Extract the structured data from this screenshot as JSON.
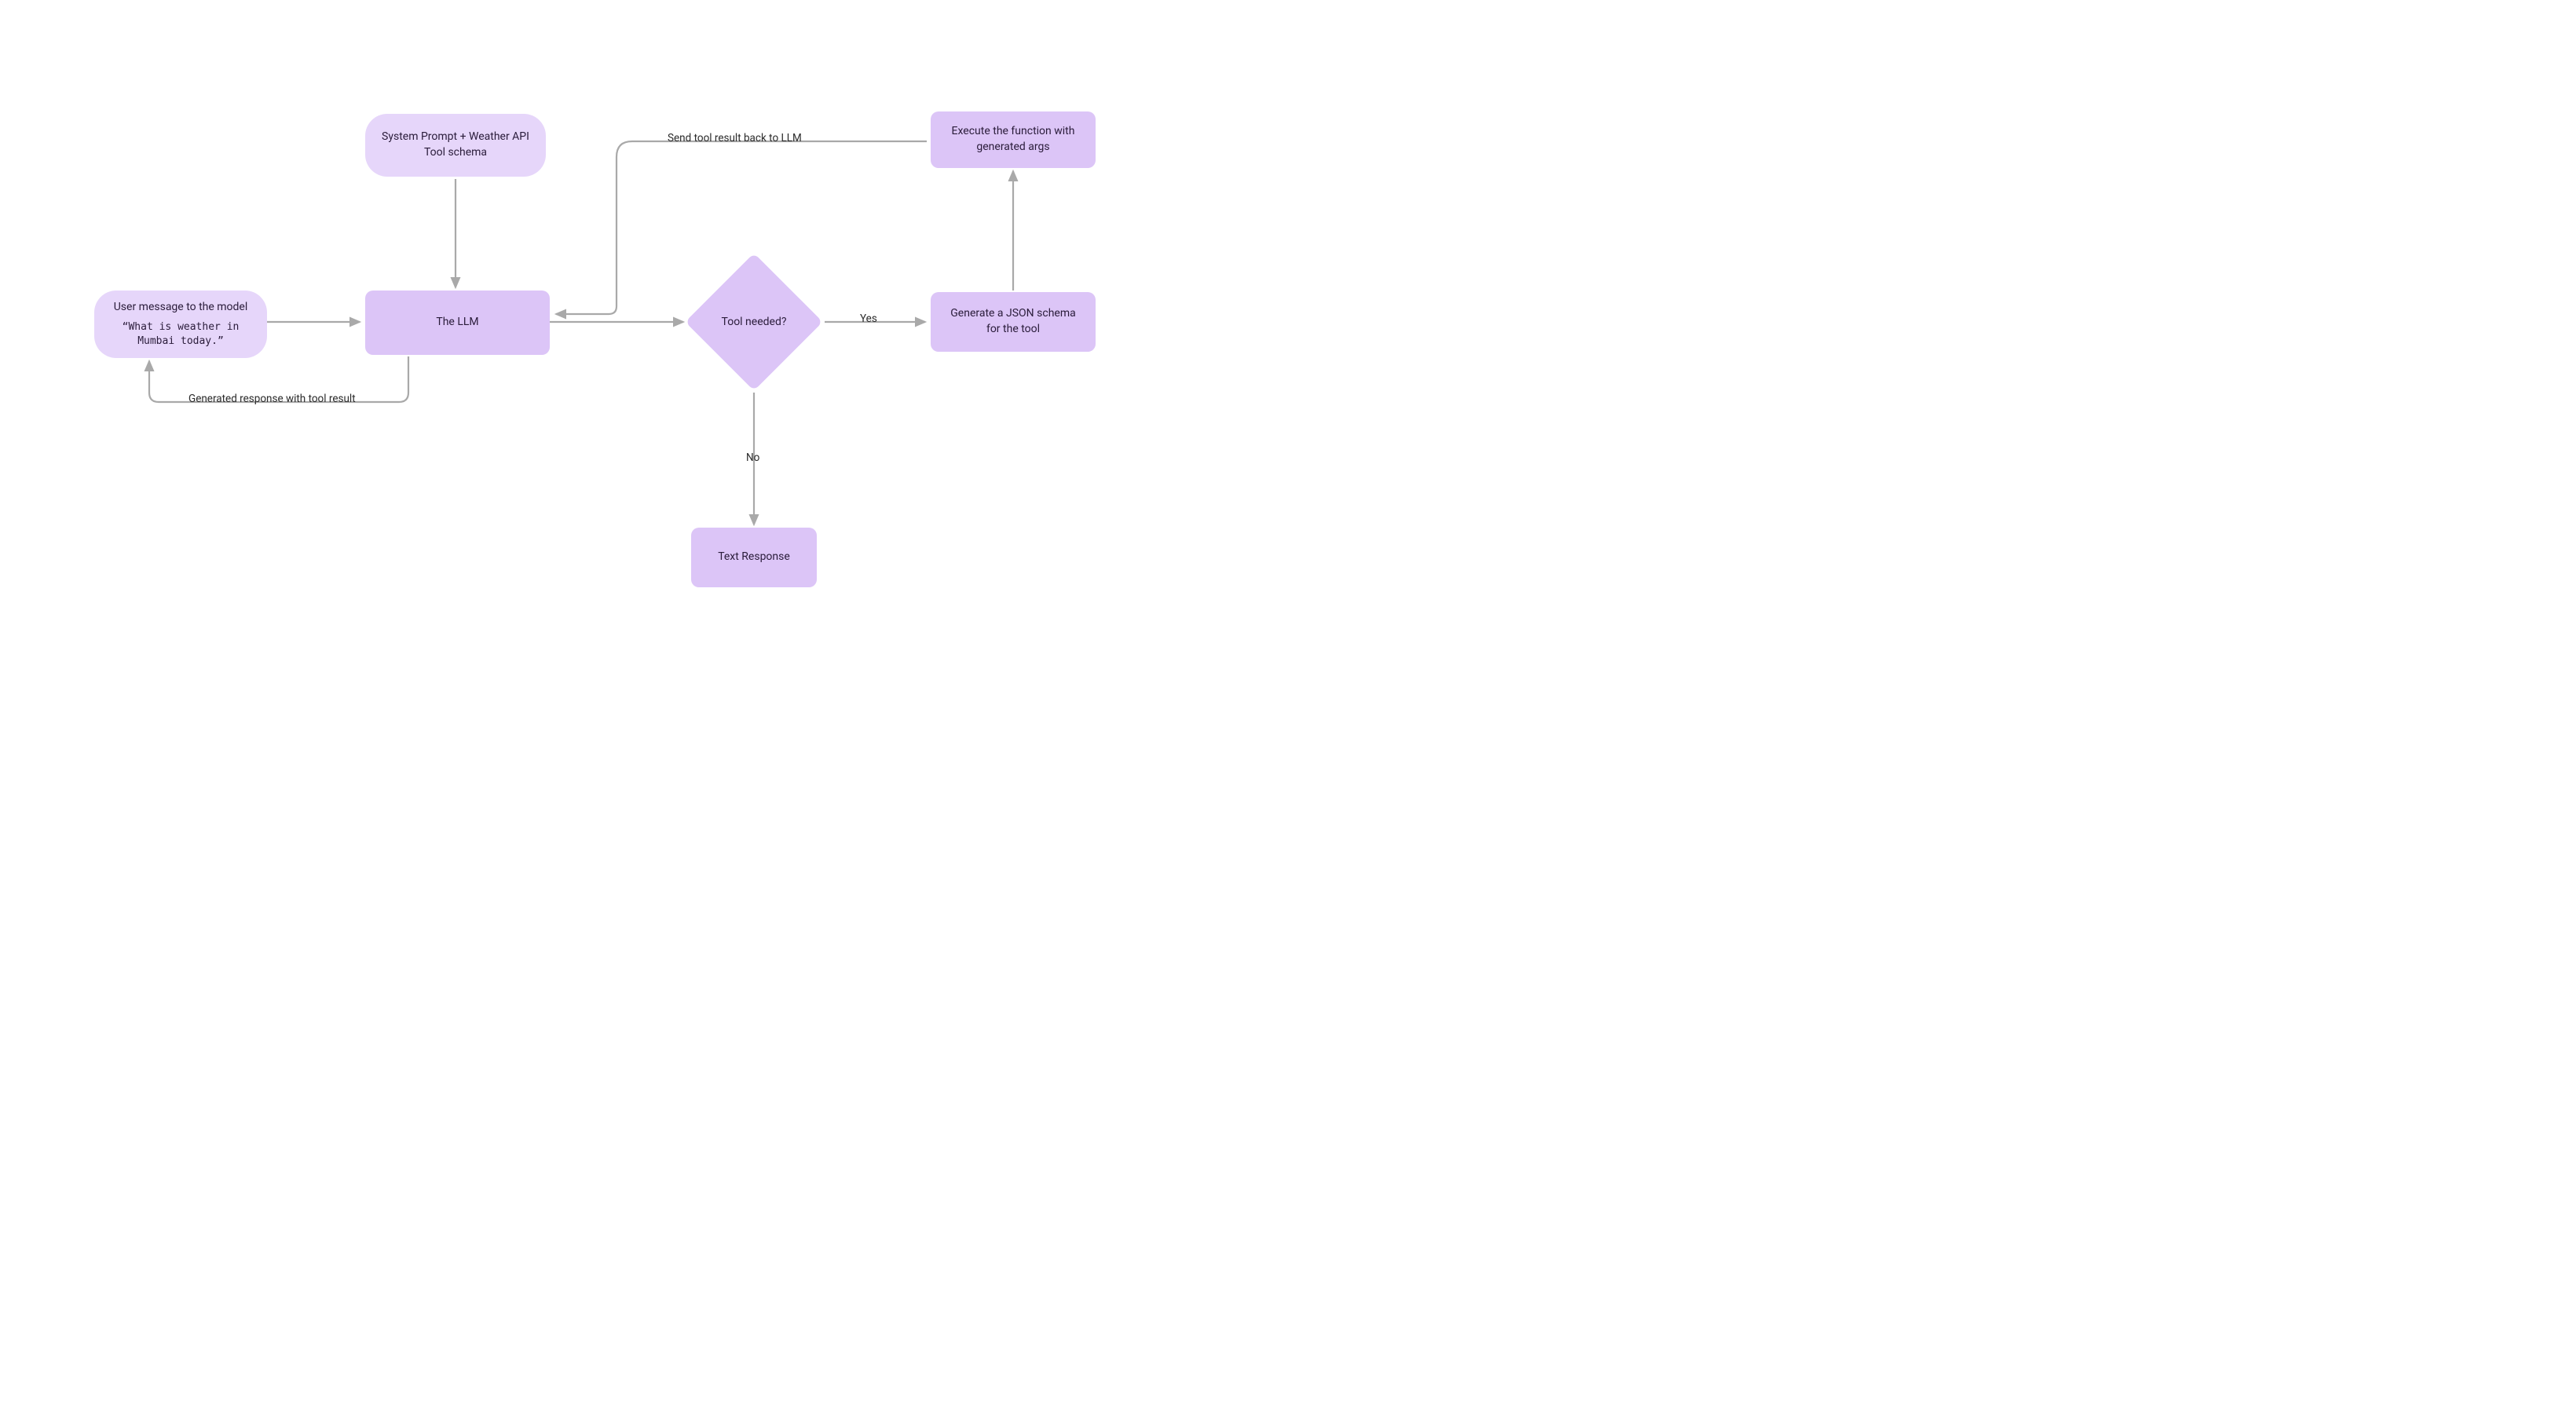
{
  "nodes": {
    "user_message": {
      "title": "User message to the model",
      "example": "“What is weather in Mumbai today.”"
    },
    "system_prompt": {
      "text": "System Prompt + Weather API Tool schema"
    },
    "llm": {
      "text": "The LLM"
    },
    "tool_needed": {
      "text": "Tool needed?"
    },
    "text_response": {
      "text": "Text Response"
    },
    "generate_json": {
      "text": "Generate a JSON schema for the tool"
    },
    "execute_function": {
      "text": "Execute the function with generated args"
    }
  },
  "edges": {
    "yes": "Yes",
    "no": "No",
    "send_tool_result": "Send tool result back to LLM",
    "generated_response": "Generated response with tool result"
  },
  "colors": {
    "pill": "#e6d6fa",
    "rect": "#dcc5f7",
    "arrow": "#a9a9a9",
    "text": "#2a1c3a"
  }
}
